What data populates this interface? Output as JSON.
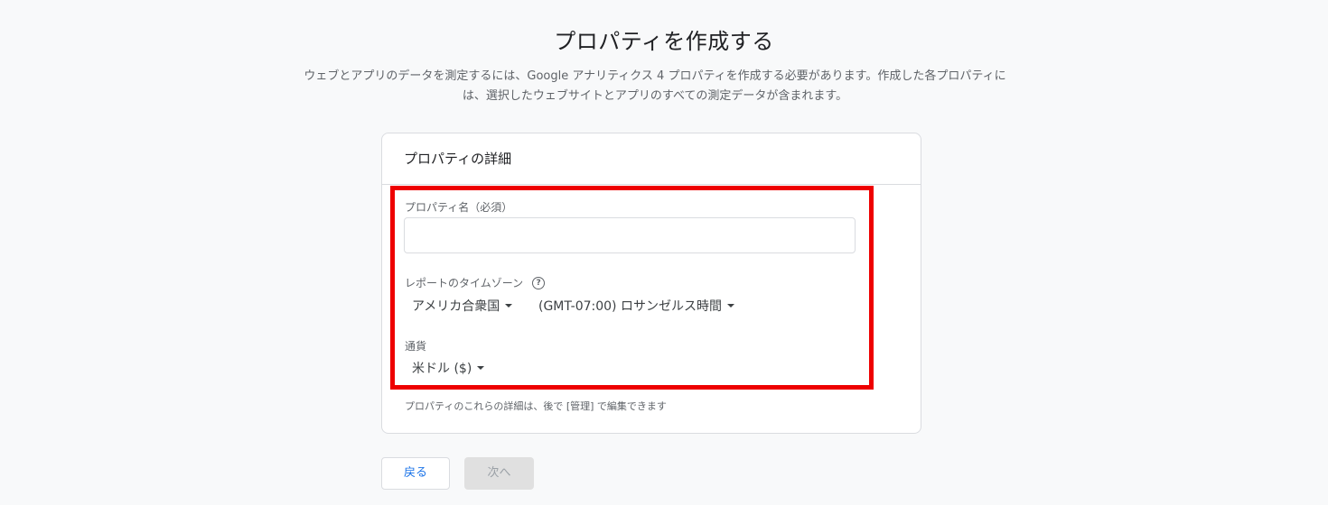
{
  "page": {
    "title": "プロパティを作成する",
    "description": "ウェブとアプリのデータを測定するには、Google アナリティクス 4 プロパティを作成する必要があります。作成した各プロパティには、選択したウェブサイトとアプリのすべての測定データが含まれます。"
  },
  "card": {
    "header": "プロパティの詳細",
    "property_name": {
      "label": "プロパティ名（必須）",
      "value": "",
      "placeholder": ""
    },
    "timezone": {
      "label": "レポートのタイムゾーン",
      "help_icon": "help-circle-icon",
      "country": "アメリカ合衆国",
      "zone": "(GMT-07:00) ロサンゼルス時間"
    },
    "currency": {
      "label": "通貨",
      "value": "米ドル ($)"
    },
    "footnote": "プロパティのこれらの詳細は、後で [管理] で編集できます"
  },
  "buttons": {
    "back": "戻る",
    "next": "次へ"
  },
  "colors": {
    "highlight": "#ee0000",
    "primary": "#1a73e8"
  }
}
